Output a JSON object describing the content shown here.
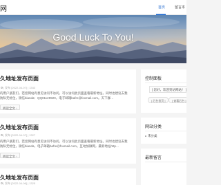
{
  "header": {
    "brand": "网",
    "nav": [
      {
        "label": "首页",
        "active": true
      },
      {
        "label": "留言本",
        "active": false
      }
    ]
  },
  "banner": {
    "title": "Good Luck To You!"
  },
  "posts": [
    {
      "title": "久地址发布页面",
      "meta": "| 发布 [2022-04-07] | 1343",
      "excerpt": [
        "的用户朋友们，若您网站有意见访问不访问，可以访问此页面查看最新地址，同时也建议去我",
        "防私无忧位，微信bianda：QQ01129920，电子邮箱bafre@foxmail.com。天下群…"
      ],
      "read_more": "阅读全文"
    },
    {
      "title": "久地址发布页面",
      "meta": "| 发布 [2022-04-07] | 1327",
      "excerpt": [
        "的用户朋友们，若您网站有意见访问不访问，可以访问此页面查看最新地址，同时也建议去我",
        "防私无忧位，微信bianda，电子邮箱bafre@foxmail.com。互动加微网，最新地址http…"
      ],
      "read_more": "阅读全文"
    },
    {
      "title": "久地址发布页面",
      "meta": "| 发布 [2022-04-06] | 1325"
    }
  ],
  "sidebar": {
    "control_panel": {
      "title": "控制面板",
      "message": "[ 您好，欢迎到访网站！ ]",
      "buttons": [
        "[ 后台首页 ]",
        "[ 查看后台 ]"
      ]
    },
    "categories": {
      "title": "网站分类",
      "items": [
        "未分类"
      ]
    },
    "comments": {
      "title": "最新留言"
    }
  },
  "colors": {
    "accent": "#3a7bd5",
    "page_bg": "#f4f4f4",
    "card_bg": "#ffffff"
  }
}
